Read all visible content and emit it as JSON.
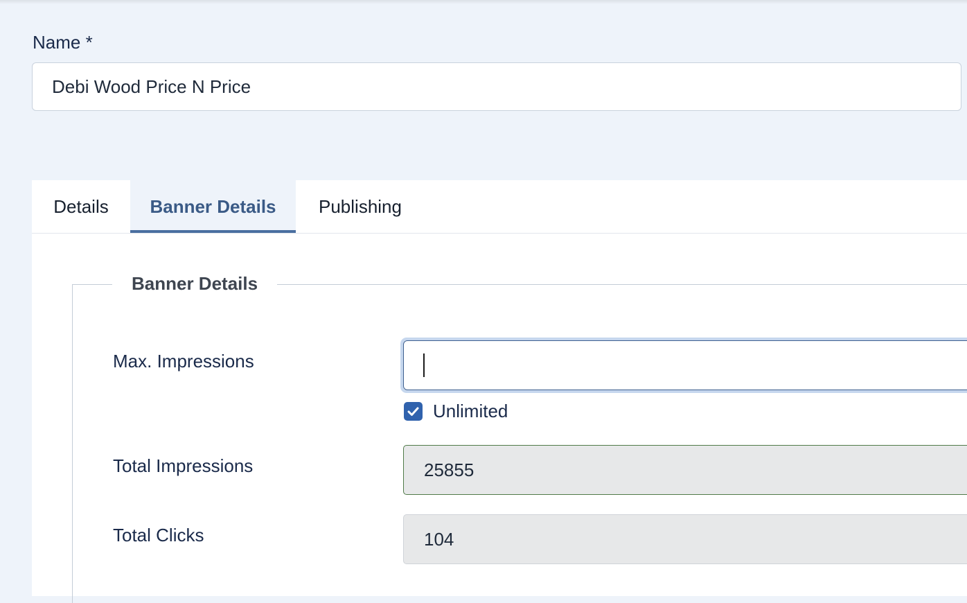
{
  "name_field": {
    "label": "Name *",
    "value": "Debi Wood Price N Price"
  },
  "tabs": [
    {
      "label": "Details",
      "active": false
    },
    {
      "label": "Banner Details",
      "active": true
    },
    {
      "label": "Publishing",
      "active": false
    }
  ],
  "banner_details": {
    "legend": "Banner Details",
    "max_impressions": {
      "label": "Max. Impressions",
      "value": "",
      "unlimited_label": "Unlimited",
      "unlimited_checked": true
    },
    "total_impressions": {
      "label": "Total Impressions",
      "value": "25855"
    },
    "total_clicks": {
      "label": "Total Clicks",
      "value": "104"
    }
  },
  "colors": {
    "page_bg": "#eef3fa",
    "active_tab_text": "#3a5a86",
    "active_tab_border": "#4a6fa0",
    "checkbox": "#3062ad"
  },
  "icons": {
    "checkbox": "check-icon"
  }
}
